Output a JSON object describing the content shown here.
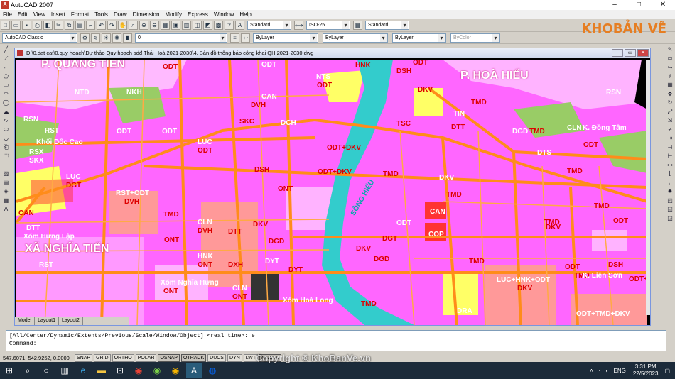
{
  "window": {
    "title": "AutoCAD 2007",
    "min": "–",
    "max": "□",
    "close": "✕"
  },
  "menu": [
    "File",
    "Edit",
    "View",
    "Insert",
    "Format",
    "Tools",
    "Draw",
    "Dimension",
    "Modify",
    "Express",
    "Window",
    "Help"
  ],
  "toolbar": {
    "text_style": "Standard",
    "dim_style": "ISO-25",
    "table_style": "Standard",
    "workspace": "AutoCAD Classic",
    "layer": "0",
    "color": "ByLayer",
    "linetype": "ByLayer",
    "lineweight": "ByLayer",
    "plotstyle": "ByColor"
  },
  "logo": {
    "part1": "KHO",
    "part2": "BẢN VẼ"
  },
  "drawing": {
    "title": "D:\\0.dat cat\\0.quy hoach\\Dự thảo Quy hoạch sdđ Thái Hoà 2021-2030\\4. Bản đồ thông báo công khai QH 2021-2030.dwg",
    "tabs": [
      "Model",
      "Layout1",
      "Layout2"
    ]
  },
  "map_labels": [
    {
      "t": "P. QUANG TIẾN"
    },
    {
      "t": "P. HOÀ HIẾU"
    },
    {
      "t": "XÃ NGHĨA TIẾN"
    },
    {
      "t": "SÔNG HIẾU"
    },
    {
      "t": "ODT"
    },
    {
      "t": "ODT"
    },
    {
      "t": "NTS"
    },
    {
      "t": "ODT"
    },
    {
      "t": "HNK"
    },
    {
      "t": "DSH"
    },
    {
      "t": "DKV"
    },
    {
      "t": "ODT"
    },
    {
      "t": "TMD"
    },
    {
      "t": "RSN"
    },
    {
      "t": "NTD"
    },
    {
      "t": "NKH"
    },
    {
      "t": "CAN"
    },
    {
      "t": "SKC"
    },
    {
      "t": "DVH"
    },
    {
      "t": "DCH"
    },
    {
      "t": "TSC"
    },
    {
      "t": "TIN"
    },
    {
      "t": "DTT"
    },
    {
      "t": "TMD"
    },
    {
      "t": "RSN"
    },
    {
      "t": "RST"
    },
    {
      "t": "ODT"
    },
    {
      "t": "ODT"
    },
    {
      "t": "ODT+DKV"
    },
    {
      "t": "DGD"
    },
    {
      "t": "DTS"
    },
    {
      "t": "CLN"
    },
    {
      "t": "K. Đồng Tâm"
    },
    {
      "t": "ODT"
    },
    {
      "t": "Khối Dốc Cao"
    },
    {
      "t": "LUC"
    },
    {
      "t": "ODT"
    },
    {
      "t": "RSX"
    },
    {
      "t": "SKX"
    },
    {
      "t": "DSH"
    },
    {
      "t": "ODT+DKV"
    },
    {
      "t": "TMD"
    },
    {
      "t": "DKV"
    },
    {
      "t": "TMD"
    },
    {
      "t": "LUC"
    },
    {
      "t": "DGT"
    },
    {
      "t": "RST+ODT"
    },
    {
      "t": "DVH"
    },
    {
      "t": "ONT"
    },
    {
      "t": "TMD"
    },
    {
      "t": "CAN"
    },
    {
      "t": "TMD"
    },
    {
      "t": "DKV"
    },
    {
      "t": "CAN"
    },
    {
      "t": "DTT"
    },
    {
      "t": "Xóm Hưng Lập"
    },
    {
      "t": "TMD"
    },
    {
      "t": "CLN"
    },
    {
      "t": "DVH"
    },
    {
      "t": "DTT"
    },
    {
      "t": "DKV"
    },
    {
      "t": "DGD"
    },
    {
      "t": "DKV"
    },
    {
      "t": "ODT"
    },
    {
      "t": "DGT"
    },
    {
      "t": "COP"
    },
    {
      "t": "TMD"
    },
    {
      "t": "ODT"
    },
    {
      "t": "ONT"
    },
    {
      "t": "RST"
    },
    {
      "t": "HNK"
    },
    {
      "t": "ONT"
    },
    {
      "t": "DXH"
    },
    {
      "t": "DYT"
    },
    {
      "t": "DYT"
    },
    {
      "t": "DGD"
    },
    {
      "t": "TMD"
    },
    {
      "t": "DSH"
    },
    {
      "t": "TMD"
    },
    {
      "t": "ODT"
    },
    {
      "t": "Xóm Nghĩa Hưng"
    },
    {
      "t": "ONT"
    },
    {
      "t": "CLN"
    },
    {
      "t": "ONT"
    },
    {
      "t": "Xóm Hoà Long"
    },
    {
      "t": "LUC+HNK+ODT"
    },
    {
      "t": "DKV"
    },
    {
      "t": "K. Liên Sơn"
    },
    {
      "t": "TMD"
    },
    {
      "t": "DRA"
    },
    {
      "t": "ODT+TMD+DKV"
    },
    {
      "t": "ODT+"
    }
  ],
  "command": {
    "history": "[All/Center/Dynamic/Extents/Previous/Scale/Window/Object] <real time>: e",
    "prompt": "Command:"
  },
  "status": {
    "coords": "547.6071, 542.9252, 0.0000",
    "buttons": [
      "SNAP",
      "GRID",
      "ORTHO",
      "POLAR",
      "OSNAP",
      "OTRACK",
      "DUCS",
      "DYN",
      "LWT",
      "MODEL"
    ]
  },
  "taskbar": {
    "time": "3:31 PM",
    "date": "22/5/2023",
    "lang": "ENG"
  },
  "watermark": "Copyright © KhoBanVe.vn",
  "colors": {
    "landuse_pink": "#ff66ff",
    "road": "#ff8c1a",
    "river": "#33cccc",
    "farmland": "#ffff66",
    "forest": "#99cc66",
    "industry": "#ff3333"
  }
}
